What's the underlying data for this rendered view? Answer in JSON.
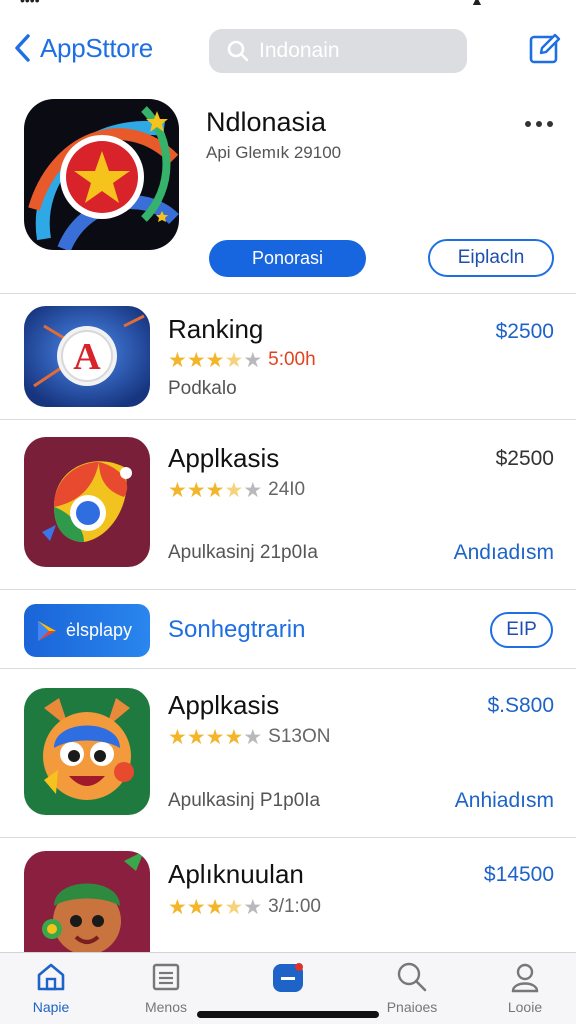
{
  "nav": {
    "back_label": "AppSttore",
    "search_placeholder": "Indonain"
  },
  "hero": {
    "title": "Ndlonasia",
    "subtitle": "Api Glemık 29100",
    "primary_button": "Ponorasi",
    "secondary_button": "Eiplacln"
  },
  "apps": [
    {
      "name": "Ranking",
      "rating": 3.5,
      "rating_text": "5:00h",
      "subtitle": "Podkalo",
      "price": "$2500",
      "action": ""
    },
    {
      "name": "Applkasis",
      "rating": 3.5,
      "rating_text": "24I0",
      "subtitle": "Apulkasinj 21p0Ia",
      "price": "$2500",
      "action": "Andıadısm"
    },
    {
      "name": "Applkasis",
      "rating": 4,
      "rating_text": "S13ON",
      "subtitle": "Apulkasinj P1p0Ia",
      "price": "$.S800",
      "action": "Anhiadısm"
    },
    {
      "name": "Aplıknuulan",
      "rating": 3.5,
      "rating_text": "3/1:00",
      "subtitle": "",
      "price": "$14500",
      "action": ""
    }
  ],
  "promo": {
    "pill_label": "ėlsplapy",
    "title": "Sonhegtrarin",
    "button": "EIP"
  },
  "tabs": [
    {
      "label": "Napie",
      "icon": "home-icon",
      "active": true
    },
    {
      "label": "Menos",
      "icon": "list-icon",
      "active": false
    },
    {
      "label": "",
      "icon": "apps-icon",
      "active": false
    },
    {
      "label": "Pnaioes",
      "icon": "search-icon",
      "active": false
    },
    {
      "label": "Looie",
      "icon": "person-icon",
      "active": false
    }
  ],
  "colors": {
    "accent": "#1e6fe3",
    "star": "#f3b52a",
    "price_red": "#e04420"
  }
}
